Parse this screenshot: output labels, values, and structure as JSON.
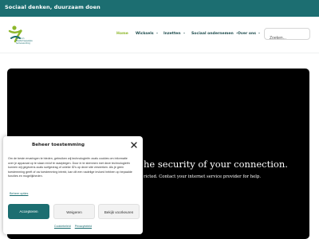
{
  "topbar": {
    "slogan": "Sociaal denken, duurzaam doen"
  },
  "header": {
    "logo_text": [
      "Centrum",
      "Maatschappelijke",
      "Samenwerking"
    ],
    "nav": [
      {
        "label": "Home",
        "active": true,
        "dropdown": false
      },
      {
        "label": "Wicksels",
        "active": false,
        "dropdown": true
      },
      {
        "label": "Inzetten",
        "active": false,
        "dropdown": true
      },
      {
        "label": "Sociaal ondernemen",
        "active": false,
        "dropdown": true
      },
      {
        "label": "Over ons",
        "active": false,
        "dropdown": true
      }
    ],
    "search_placeholder": "Zoeken..."
  },
  "video": {
    "headline": "he security of your connection.",
    "sub": "ricted. Contact your internet service provider for help."
  },
  "consent": {
    "title": "Beheer toestemming",
    "body": "Om de beste ervaringen te bieden, gebruiken wij technologieën zoals cookies om informatie over je apparaat op te slaan en/of te raadplegen. Door in te stemmen met deze technologieën kunnen wij gegevens zoals surfgedrag of unieke ID's op deze site verwerken. Als je geen toestemming geeft of uw toestemming intrekt, kan dit een nadelige invloed hebben op bepaalde functies en mogelijkheden.",
    "manage": "Beheer opties",
    "buttons": {
      "accept": "Accepteren",
      "deny": "Weigeren",
      "prefs": "Bekijk voorkeuren"
    },
    "links": {
      "cookie": "Cookiebeleid",
      "privacy": "Privacybeleid"
    }
  },
  "colors": {
    "brand": "#1c6e71",
    "accent": "#8db72a"
  }
}
